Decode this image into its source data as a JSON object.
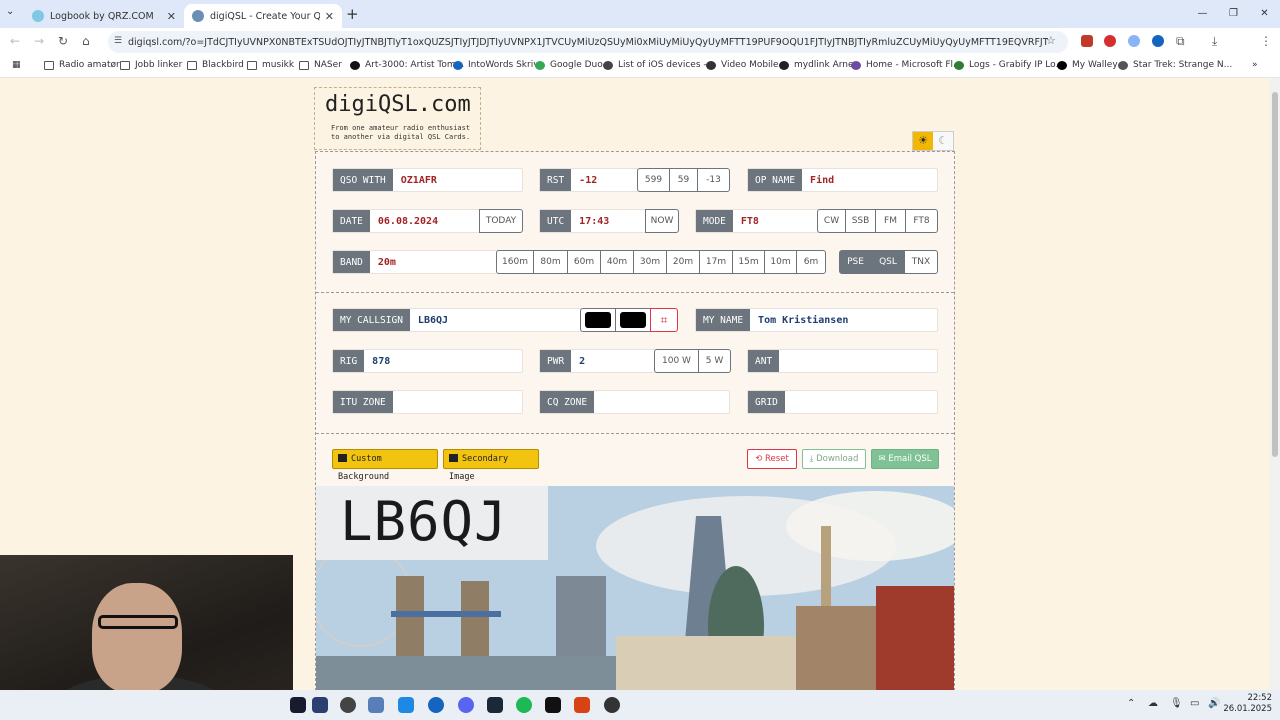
{
  "browser": {
    "tabs": [
      {
        "title": "Logbook by QRZ.COM",
        "active": false
      },
      {
        "title": "digiQSL - Create Your QSL Card",
        "active": true
      }
    ],
    "url": "digiqsl.com/?o=JTdCJTIyUVNPX0NBTExTSUdOJTIyJTNBJTIyT1oxQUZSJTIyJTJDJTIyUVNPX1JTVCUyMiUzQSUyMi0xMiUyMiUyQyUyMFTT19PUF9OQU1FJTIyJTNBJTIyRmluZCUyMiUyQyUyMFTT19EQVRFJTIyJTNBJTIyMDYuM...",
    "bookmarks": [
      "Radio amatør",
      "Jobb linker",
      "Blackbird",
      "musikk",
      "NASer",
      "Art-3000: Artist Tom...",
      "IntoWords Skriv",
      "Google Duo",
      "List of iOS devices -...",
      "Video Mobile",
      "mydlink Arne",
      "Home - Microsoft Fl...",
      "Logs - Grabify IP Lo...",
      "My Walley",
      "Star Trek: Strange N..."
    ]
  },
  "site": {
    "logo": "digiQSL.com",
    "tagline": "From one amateur radio enthusiast to another via digital QSL Cards."
  },
  "qso": {
    "qso_with": {
      "label": "QSO WITH",
      "value": "OZ1AFR"
    },
    "rst": {
      "label": "RST",
      "value": "-12",
      "presets": [
        "599",
        "59",
        "-13"
      ]
    },
    "op_name": {
      "label": "OP NAME",
      "value": "Find"
    },
    "date": {
      "label": "DATE",
      "value": "06.08.2024",
      "button": "TODAY"
    },
    "utc": {
      "label": "UTC",
      "value": "17:43",
      "button": "NOW"
    },
    "mode": {
      "label": "MODE",
      "value": "FT8",
      "presets": [
        "CW",
        "SSB",
        "FM",
        "FT8"
      ]
    },
    "band": {
      "label": "BAND",
      "value": "20m",
      "presets": [
        "160m",
        "80m",
        "60m",
        "40m",
        "30m",
        "20m",
        "17m",
        "15m",
        "10m",
        "6m"
      ]
    },
    "qsl": {
      "options": [
        "PSE",
        "QSL",
        "TNX"
      ],
      "selected": [
        "PSE",
        "QSL"
      ]
    }
  },
  "station": {
    "my_callsign": {
      "label": "MY CALLSIGN",
      "value": "LB6QJ"
    },
    "my_name": {
      "label": "MY NAME",
      "value": "Tom Kristiansen"
    },
    "rig": {
      "label": "RIG",
      "value": "878"
    },
    "pwr": {
      "label": "PWR",
      "value": "2",
      "presets": [
        "100 W",
        "5 W"
      ]
    },
    "ant": {
      "label": "ANT",
      "value": ""
    },
    "itu_zone": {
      "label": "ITU ZONE",
      "value": ""
    },
    "cq_zone": {
      "label": "CQ ZONE",
      "value": ""
    },
    "grid": {
      "label": "GRID",
      "value": ""
    }
  },
  "actions": {
    "custom_background": "Custom Background",
    "secondary_image": "Secondary Image",
    "reset": "Reset",
    "download": "Download",
    "email": "Email QSL"
  },
  "card_preview": {
    "callsign": "LB6QJ"
  },
  "taskbar": {
    "time": "22:52",
    "date": "26.01.2025"
  },
  "colors": {
    "value_red": "#a12525",
    "value_blue": "#1f3e6e",
    "label_bg": "#6c757d",
    "yellow": "#f2c40f"
  }
}
